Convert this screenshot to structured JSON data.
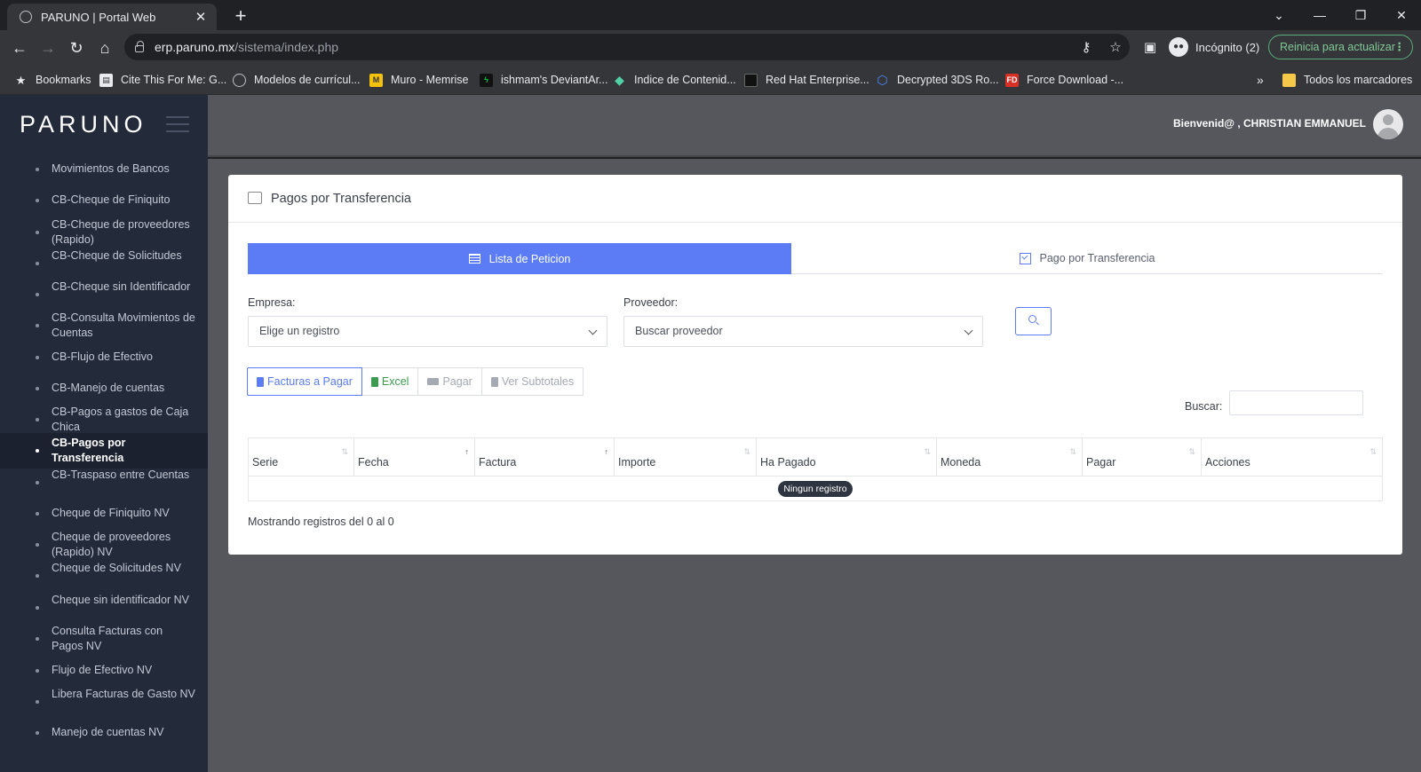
{
  "browser": {
    "tab_title": "PARUNO | Portal Web",
    "url_host": "erp.paruno.mx",
    "url_path": "/sistema/index.php",
    "incognito_label": "Incógnito (2)",
    "update_label": "Reinicia para actualizar",
    "bookmarks": [
      "Bookmarks",
      "Cite This For Me: G...",
      "Modelos de currícul...",
      "Muro - Memrise",
      "ishmam's DeviantAr...",
      "Indice de Contenid...",
      "Red Hat Enterprise...",
      "Decrypted 3DS Ro...",
      "Force Download -...",
      "Todos los marcadores"
    ]
  },
  "app": {
    "brand": "PARUNO",
    "welcome": "Bienvenid@ ,  CHRISTIAN EMMANUEL"
  },
  "sidebar": {
    "items": [
      "Movimientos de Bancos",
      "CB-Cheque de Finiquito",
      "CB-Cheque de proveedores (Rapido)",
      "CB-Cheque de Solicitudes",
      "CB-Cheque sin Identificador",
      "CB-Consulta Movimientos de Cuentas",
      "CB-Flujo de Efectivo",
      "CB-Manejo de cuentas",
      "CB-Pagos a gastos de Caja Chica",
      "CB-Pagos por Transferencia",
      "CB-Traspaso entre Cuentas",
      "Cheque de Finiquito NV",
      "Cheque de proveedores (Rapido) NV",
      "Cheque de Solicitudes NV",
      "Cheque sin identificador NV",
      "Consulta Facturas con Pagos NV",
      "Flujo de Efectivo NV",
      "Libera Facturas de Gasto NV",
      "Manejo de cuentas NV"
    ],
    "active_index": 9
  },
  "page": {
    "title": "Pagos por Transferencia",
    "tabs": [
      "Lista de Peticion",
      "Pago por Transferencia"
    ],
    "empresa_label": "Empresa:",
    "empresa_value": "Elige un registro",
    "proveedor_label": "Proveedor:",
    "proveedor_value": "Buscar proveedor",
    "buttons": [
      "Facturas a Pagar",
      "Excel",
      "Pagar",
      "Ver Subtotales"
    ],
    "buscar_label": "Buscar:",
    "columns": [
      "Serie",
      "Fecha",
      "Factura",
      "Importe",
      "Ha Pagado",
      "Moneda",
      "Pagar",
      "Acciones"
    ],
    "empty_text": "Ningun registro",
    "footer": "Mostrando registros del 0 al 0"
  },
  "colors": {
    "accent": "#5b7cf5",
    "sidebar_bg": "#232a3a",
    "excel_green": "#3c9b4e"
  }
}
